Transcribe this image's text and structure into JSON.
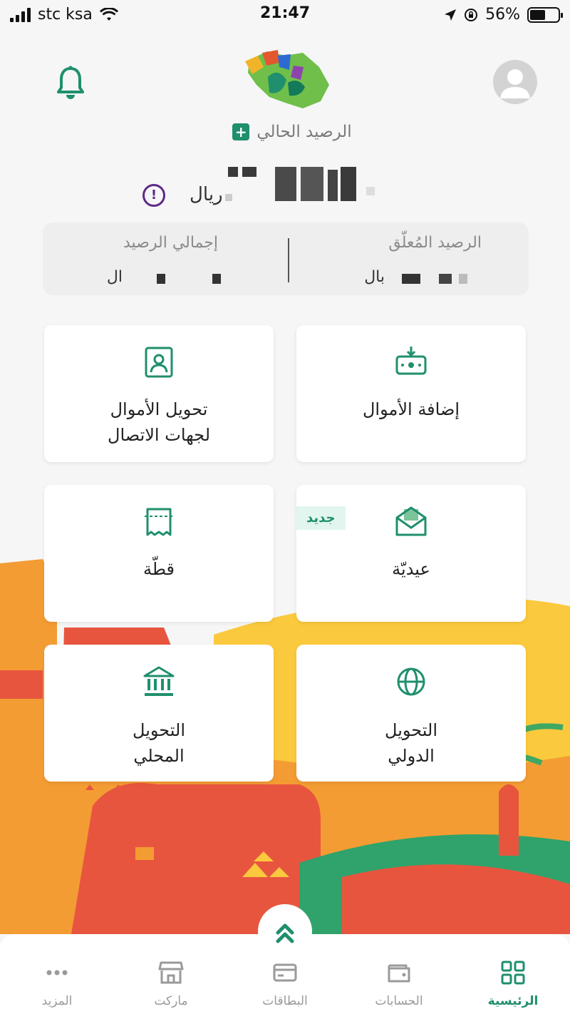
{
  "status_bar": {
    "carrier": "stc ksa",
    "time": "21:47",
    "battery": "56%",
    "battery_level": 0.56
  },
  "header": {
    "balance_label": "الرصيد الحالي",
    "add_symbol": "+",
    "currency": "ريال",
    "info_symbol": "!"
  },
  "summary": {
    "pending_label": "الرصيد المُعلّق",
    "pending_value": "بال",
    "total_label": "إجمالي الرصيد",
    "total_value": "ال"
  },
  "actions": [
    {
      "label": "إضافة الأموال",
      "icon": "add-money-icon"
    },
    {
      "label": "تحويل الأموال\nلجهات الاتصال",
      "icon": "contact-card-icon"
    },
    {
      "label": "عيديّة",
      "icon": "envelope-icon",
      "badge": "جديد"
    },
    {
      "label": "قطّة",
      "icon": "receipt-icon"
    },
    {
      "label": "التحويل\nالدولي",
      "icon": "globe-icon"
    },
    {
      "label": "التحويل\nالمحلي",
      "icon": "bank-icon"
    }
  ],
  "tabs": [
    {
      "label": "الرئيسية",
      "icon": "home-grid-icon",
      "active": true
    },
    {
      "label": "الحسابات",
      "icon": "wallet-icon",
      "active": false
    },
    {
      "label": "البطاقات",
      "icon": "card-icon",
      "active": false
    },
    {
      "label": "ماركت",
      "icon": "store-icon",
      "active": false
    },
    {
      "label": "المزيد",
      "icon": "more-dots-icon",
      "active": false
    }
  ],
  "colors": {
    "brand_green": "#1f8f6d",
    "info_purple": "#5e2a86",
    "inactive_gray": "#9a9a9a"
  }
}
